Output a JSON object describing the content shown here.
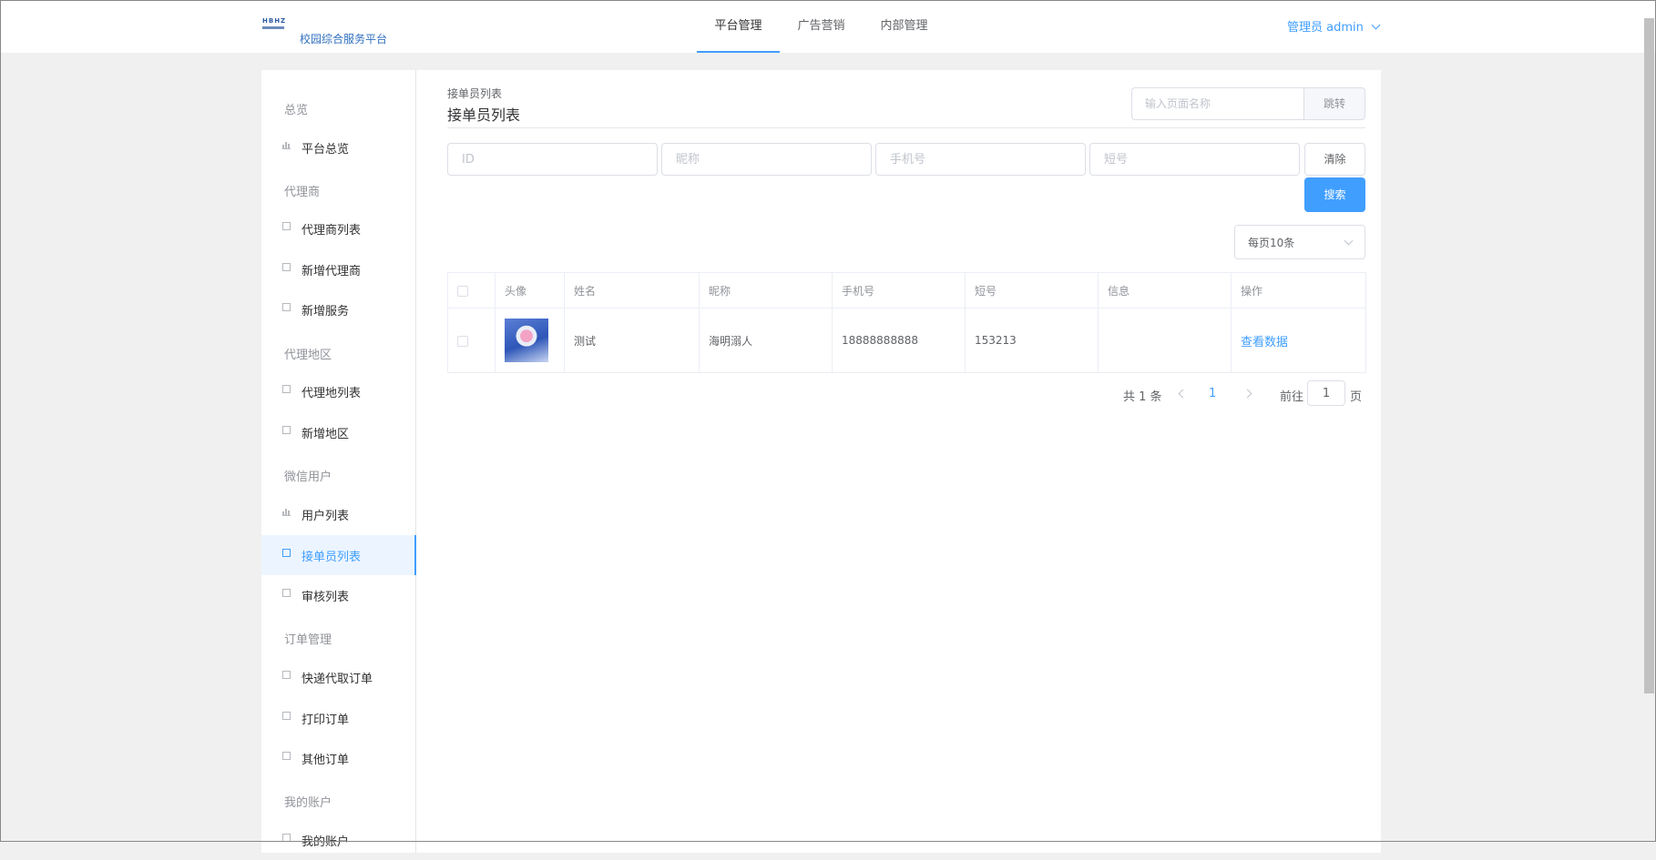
{
  "header": {
    "logo_mark": "HBHZ",
    "logo_text": "校园综合服务平台",
    "tabs": [
      {
        "label": "平台管理"
      },
      {
        "label": "广告营销"
      },
      {
        "label": "内部管理"
      }
    ],
    "user_label": "管理员 admin"
  },
  "sidebar": {
    "groups": [
      "总览",
      "代理商",
      "代理地区",
      "微信用户",
      "订单管理",
      "我的账户"
    ],
    "items": [
      {
        "label": "平台总览",
        "icon": "bar-chart-icon"
      },
      {
        "label": "代理商列表",
        "icon": "calendar-icon"
      },
      {
        "label": "新增代理商",
        "icon": "edit-icon"
      },
      {
        "label": "新增服务",
        "icon": "edit-icon"
      },
      {
        "label": "代理地列表",
        "icon": "calendar-icon"
      },
      {
        "label": "新增地区",
        "icon": "edit-icon"
      },
      {
        "label": "用户列表",
        "icon": "bar-chart-icon"
      },
      {
        "label": "接单员列表",
        "icon": "document-icon"
      },
      {
        "label": "审核列表",
        "icon": "document-icon"
      },
      {
        "label": "快递代取订单",
        "icon": "document-icon"
      },
      {
        "label": "打印订单",
        "icon": "document-icon"
      },
      {
        "label": "其他订单",
        "icon": "document-icon"
      },
      {
        "label": "我的账户",
        "icon": "document-icon"
      }
    ]
  },
  "main": {
    "breadcrumb": "接单员列表",
    "title": "接单员列表",
    "jump_placeholder": "输入页面名称",
    "jump_label": "跳转",
    "filters": {
      "id_placeholder": "ID",
      "nickname_placeholder": "昵称",
      "phone_placeholder": "手机号",
      "short_placeholder": "短号"
    },
    "clear_label": "清除",
    "search_label": "搜索",
    "page_size": "每页10条",
    "table": {
      "columns": [
        "头像",
        "姓名",
        "昵称",
        "手机号",
        "短号",
        "信息",
        "操作"
      ],
      "rows": [
        {
          "name": "测试",
          "nickname": "海明溺人",
          "phone": "18888888888",
          "short": "153213",
          "info": "",
          "action": "查看数据"
        }
      ]
    },
    "pagination": {
      "total": "共 1 条",
      "current": "1",
      "goto_prefix": "前往",
      "goto_value": "1",
      "goto_suffix": "页"
    }
  },
  "colors": {
    "accent": "#409eff",
    "active_bg": "#ecf5ff"
  }
}
